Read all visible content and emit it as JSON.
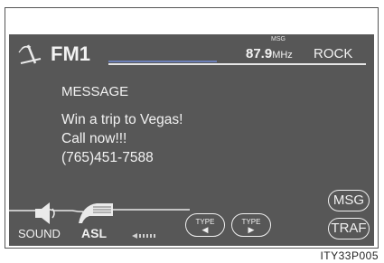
{
  "header": {
    "band": "FM1",
    "msg_indicator": "MSG",
    "frequency": "87.9",
    "frequency_unit": "MHz",
    "genre": "ROCK"
  },
  "message": {
    "title": "MESSAGE",
    "lines": [
      "Win a trip to Vegas!",
      "Call now!!!",
      "(765)451-7588"
    ]
  },
  "controls": {
    "sound_label": "SOUND",
    "asl_label": "ASL",
    "type_prev_label": "TYPE",
    "type_prev_arrow": "◀",
    "type_next_label": "TYPE",
    "type_next_arrow": "▶",
    "msg_button": "MSG",
    "traf_button": "TRAF"
  },
  "caption": "ITY33P005",
  "colors": {
    "screen_bg": "#575757",
    "text": "#f2f2f2",
    "accent_line": "#6c7fb8"
  }
}
